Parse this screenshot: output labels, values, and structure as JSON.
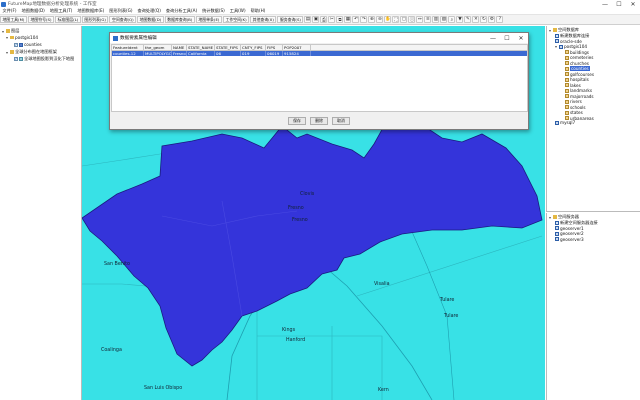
{
  "window": {
    "title": "FutureMap地理数据分析处理系统 - 工作室",
    "min_glyph": "—",
    "max_glyph": "☐",
    "close_glyph": "✕"
  },
  "menubar": {
    "items": [
      "文件(F)",
      "地图数据(D)",
      "地图工具(T)",
      "地图数据库(E)",
      "图形列表(G)",
      "查询处理(Q)",
      "查询分析工具(A)",
      "统计数据(S)",
      "工具(W)",
      "帮助(H)"
    ]
  },
  "toolbar": {
    "buttons": [
      "地图工具(M)",
      "地图符号(S)",
      "标准图层(L)",
      "图形列表(G)",
      "空间查询(Q)",
      "地图数据(D)",
      "数据库查询(B)",
      "地图单条(E)",
      "工作空间(K)",
      "其他查询(X)",
      "服务查询(S)"
    ],
    "icons": [
      "open-icon",
      "save-icon",
      "print-icon",
      "cut-icon",
      "copy-icon",
      "paste-icon",
      "undo-icon",
      "redo-icon",
      "zoom-in-icon",
      "zoom-out-icon",
      "pan-icon",
      "full-extent-icon",
      "select-icon",
      "identify-icon",
      "measure-icon",
      "layer-icon",
      "table-icon",
      "chart-icon",
      "search-icon",
      "filter-icon",
      "edit-icon",
      "delete-icon",
      "refresh-icon",
      "settings-icon",
      "help-icon"
    ],
    "icon_glyphs": [
      "▤",
      "▣",
      "⎙",
      "✂",
      "⧉",
      "▦",
      "↶",
      "↷",
      "⊕",
      "⊖",
      "✋",
      "⛶",
      "▢",
      "ⓘ",
      "↔",
      "≡",
      "▥",
      "▧",
      "⌕",
      "▼",
      "✎",
      "✕",
      "↻",
      "⚙",
      "?"
    ]
  },
  "layer_tree": {
    "root": "图层",
    "map_group": "postgis104",
    "map_layer": "counties",
    "sub_group": "全球分布图在地图框架",
    "sub_layer": "全球地图投影到汉化下地图"
  },
  "catalog": {
    "title": "空间数据库",
    "db_item": "新建数据库连接",
    "conn1": "oracle-sde",
    "conn2": "postgis104",
    "tables": [
      "buildings",
      "cemeteries",
      "churches",
      "counties",
      "golfcourses",
      "hospitals",
      "lakes",
      "landmarks",
      "majorroads",
      "rivers",
      "schools",
      "states",
      "urbanareas"
    ],
    "selected_table": "counties",
    "extra": "mysql7"
  },
  "services": {
    "title": "空间服务器",
    "root": "新建空间服务器连接",
    "items": [
      "geoserver1",
      "geoserver2",
      "geoserver3"
    ]
  },
  "dialog": {
    "title": "数据要素属性编辑",
    "columns": [
      "FeatureIdent",
      "the_geom",
      "NAME",
      "STATE_NAME",
      "STATE_FIPS",
      "CNTY_FIPS",
      "FIPS",
      "POP2007"
    ],
    "row": [
      "counties.12",
      "MULTIPOLYGON",
      "Fresno",
      "California",
      "06",
      "019",
      "06019",
      "915824"
    ],
    "buttons": [
      "保存",
      "删除",
      "取消"
    ]
  },
  "map": {
    "labels": [
      "Fresno",
      "Clovis",
      "Fresno",
      "San Benito",
      "Visalia",
      "Kings",
      "Tulare",
      "Hanford",
      "Coalinga",
      "San Luis Obispo",
      "Kern",
      "Tulare"
    ],
    "county_fill": "#3434da",
    "background": "#38e1e6",
    "outline": "#1a1a80"
  },
  "colors": {
    "selection": "#3b69d2",
    "panel_border": "#bbbbbb"
  }
}
